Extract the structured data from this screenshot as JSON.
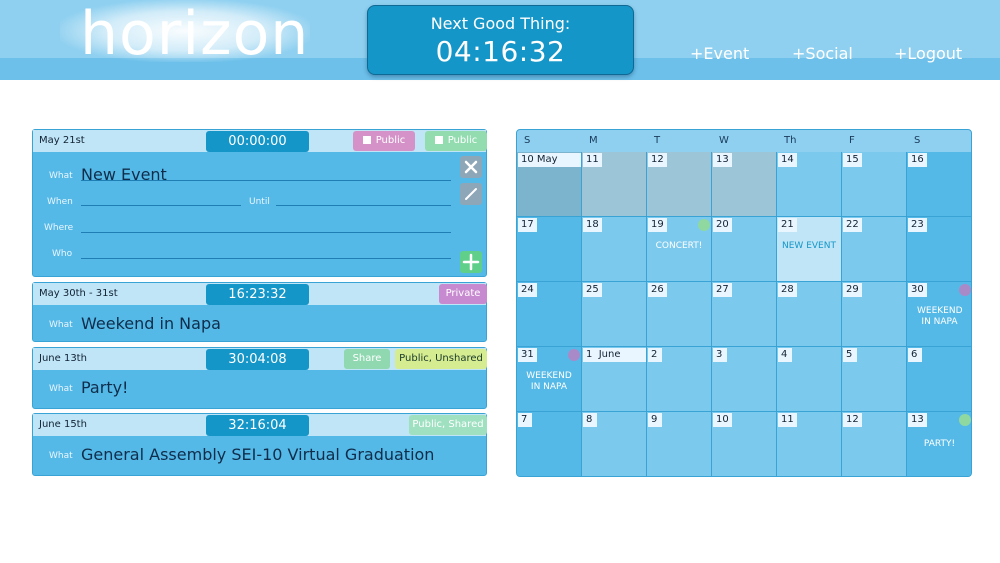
{
  "header": {
    "logo": "horizon",
    "next_title": "Next Good Thing:",
    "next_time": "04:16:32",
    "nav": [
      "+Event",
      "+Social",
      "+Logout"
    ]
  },
  "colors": {
    "header_bg": "#8fd0f0",
    "accent": "#1596c8",
    "tag_public_pink": "#d592c8",
    "tag_public_green": "#92dcb0",
    "tag_private": "#c78ad0",
    "tag_share": "#8fd8b0",
    "tag_unshared": "#d6ec90",
    "tag_shared": "#9ee0c0",
    "dot_purple": "#a98ac8",
    "dot_green": "#8fd8a0"
  },
  "events": [
    {
      "date": "May 21st",
      "timer": "00:00:00",
      "tags": [
        "Public",
        "Public"
      ],
      "what_label": "What",
      "what_value": "New Event",
      "when_label": "When",
      "until_label": "Until",
      "where_label": "Where",
      "who_label": "Who",
      "icons": [
        "close-icon",
        "edit-icon",
        "plus-icon"
      ]
    },
    {
      "date": "May 30th - 31st",
      "timer": "16:23:32",
      "tags": [
        "Private"
      ],
      "what_label": "What",
      "what_value": "Weekend in Napa"
    },
    {
      "date": "June 13th",
      "timer": "30:04:08",
      "tags": [
        "Share",
        "Public, Unshared"
      ],
      "what_label": "What",
      "what_value": "Party!"
    },
    {
      "date": "June 15th",
      "timer": "32:16:04",
      "tags": [
        "Public, Shared"
      ],
      "what_label": "What",
      "what_value": "General Assembly SEI-10 Virtual Graduation"
    }
  ],
  "calendar": {
    "days_of_week": [
      "S",
      "M",
      "T",
      "W",
      "Th",
      "F",
      "S"
    ],
    "weeks": [
      [
        "10 May",
        "11",
        "12",
        "13",
        "14",
        "15",
        "16"
      ],
      [
        "17",
        "18",
        "19",
        "20",
        "21",
        "22",
        "23"
      ],
      [
        "24",
        "25",
        "26",
        "27",
        "28",
        "29",
        "30"
      ],
      [
        "31",
        "1  June",
        "2",
        "3",
        "4",
        "5",
        "6"
      ],
      [
        "7",
        "8",
        "9",
        "10",
        "11",
        "12",
        "13"
      ]
    ],
    "events": {
      "concert": "CONCERT!",
      "new_event": "NEW EVENT",
      "weekend_a": "WEEKEND IN NAPA",
      "weekend_b": "WEEKEND IN NAPA",
      "party": "PARTY!"
    }
  }
}
